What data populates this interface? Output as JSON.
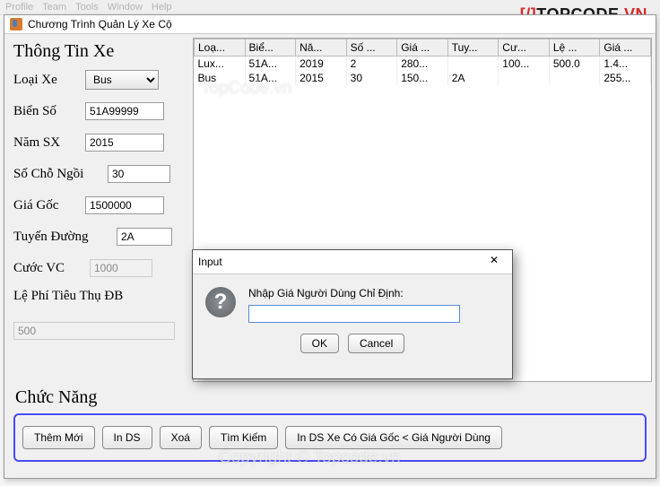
{
  "menubar": [
    "Profile",
    "Team",
    "Tools",
    "Window",
    "Help"
  ],
  "logo": {
    "pre": "[/]",
    "main": "TOPCODE",
    "suf": ".VN"
  },
  "window": {
    "title": "Chương Trình Quản Lý Xe Cộ"
  },
  "info": {
    "title": "Thông Tin Xe",
    "loaiXe": {
      "label": "Loại Xe",
      "value": "Bus"
    },
    "bienSo": {
      "label": "Biển Số",
      "value": "51A99999"
    },
    "namSX": {
      "label": "Năm SX",
      "value": "2015"
    },
    "soCho": {
      "label": "Số Chỗ Ngồi",
      "value": "30"
    },
    "giaGoc": {
      "label": "Giá Gốc",
      "value": "1500000"
    },
    "tuyen": {
      "label": "Tuyến Đường",
      "value": "2A"
    },
    "cuoc": {
      "label": "Cước VC",
      "value": "1000"
    },
    "lePhi": {
      "label": "Lệ Phí Tiêu Thụ ĐB",
      "value": "500"
    }
  },
  "table": {
    "cols": [
      "Loạ...",
      "Biể...",
      "Nă...",
      "Số ...",
      "Giá ...",
      "Tuy...",
      "Cư...",
      "Lệ ...",
      "Giá ..."
    ],
    "rows": [
      [
        "Lux...",
        "51A...",
        "2019",
        "2",
        "280...",
        "",
        "100...",
        "500.0",
        "1.4..."
      ],
      [
        "Bus",
        "51A...",
        "2015",
        "30",
        "150...",
        "2A",
        "",
        "",
        "255..."
      ]
    ]
  },
  "functions": {
    "title": "Chức Năng",
    "buttons": [
      "Thêm Mới",
      "In DS",
      "Xoá",
      "Tìm Kiếm",
      "In DS Xe Có Giá Gốc < Giá Người Dùng"
    ]
  },
  "dialog": {
    "title": "Input",
    "prompt": "Nhập Giá Người Dùng Chỉ Định:",
    "value": "",
    "ok": "OK",
    "cancel": "Cancel",
    "close": "✕"
  },
  "watermarks": {
    "wm1": "TopCode.vn",
    "wm2": "Copyright © Topcode.vn"
  }
}
